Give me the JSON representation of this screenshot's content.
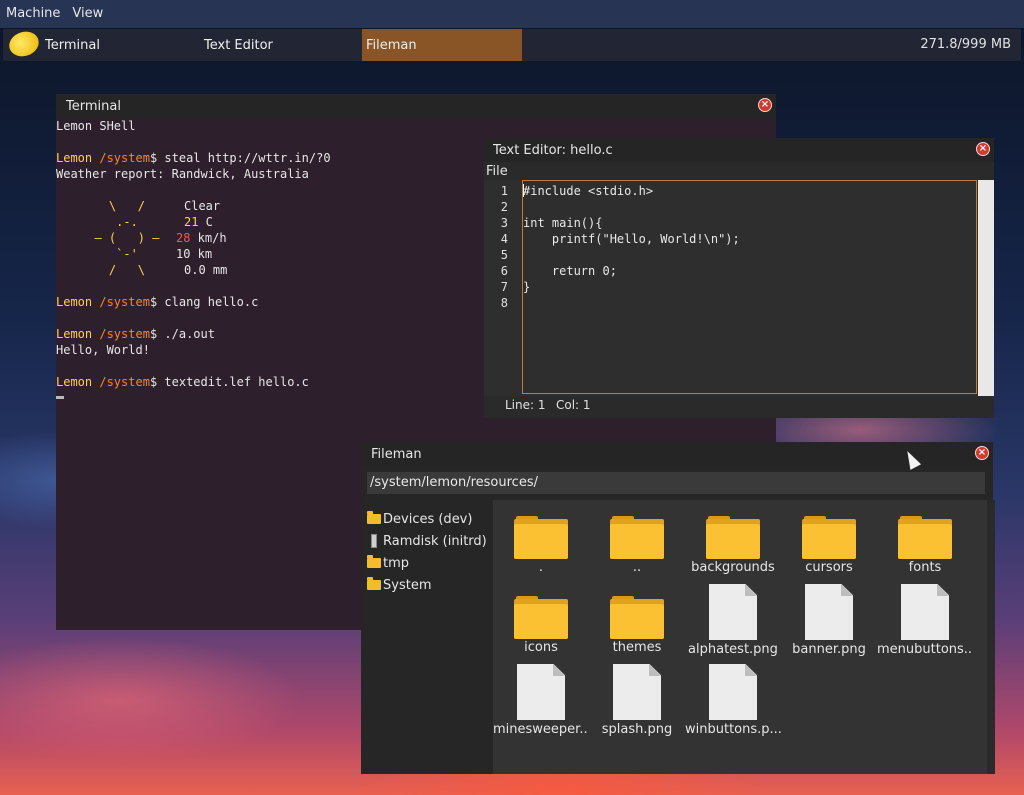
{
  "host_menu": [
    "Machine",
    "View"
  ],
  "taskbar": {
    "tasks": [
      "Terminal",
      "Text Editor",
      "Fileman"
    ],
    "active_task": "Fileman",
    "memory": "271.8/999 MB",
    "logo_icon": "lemon-icon"
  },
  "terminal": {
    "title": "Terminal",
    "shell_name": "Lemon SHell",
    "prompt_user": "Lemon",
    "prompt_path": "/system",
    "prompt_suffix": "$ ",
    "cmd1": "steal http://wttr.in/?0",
    "weather_header": "Weather report: Randwick, Australia",
    "art1": "    \\   /",
    "art2": "     .-.",
    "art3": "  ― (   ) ―",
    "art4": "     `-'",
    "art5": "    /   \\",
    "condition": "Clear",
    "temp_value": "21",
    "temp_unit": " C",
    "wind_value": "28",
    "wind_unit": " km/h",
    "visibility": "10 km",
    "precip": "0.0 mm",
    "cmd2": "clang hello.c",
    "cmd3": "./a.out",
    "output": "Hello, World!",
    "cmd4": "textedit.lef hello.c"
  },
  "text_editor": {
    "title": "Text Editor: hello.c",
    "menu_file": "File",
    "line_numbers": [
      "1",
      "2",
      "3",
      "4",
      "5",
      "6",
      "7",
      "8"
    ],
    "code_lines": [
      "#include <stdio.h>",
      "",
      "int main(){",
      "    printf(\"Hello, World!\\n\");",
      "",
      "    return 0;",
      "}",
      ""
    ],
    "status_line": "Line: 1",
    "status_col": "Col: 1"
  },
  "fileman": {
    "title": "Fileman",
    "path": "/system/lemon/resources/",
    "sidebar": [
      {
        "label": "Devices (dev)",
        "icon": "folder-icon"
      },
      {
        "label": "Ramdisk (initrd)",
        "icon": "drive-icon"
      },
      {
        "label": "tmp",
        "icon": "folder-icon"
      },
      {
        "label": "System",
        "icon": "folder-icon"
      }
    ],
    "items": [
      {
        "label": ".",
        "type": "folder"
      },
      {
        "label": "..",
        "type": "folder"
      },
      {
        "label": "backgrounds",
        "type": "folder"
      },
      {
        "label": "cursors",
        "type": "folder"
      },
      {
        "label": "fonts",
        "type": "folder"
      },
      {
        "label": "icons",
        "type": "folder"
      },
      {
        "label": "themes",
        "type": "folder"
      },
      {
        "label": "alphatest.png",
        "type": "file"
      },
      {
        "label": "banner.png",
        "type": "file"
      },
      {
        "label": "menubuttons....",
        "type": "file"
      },
      {
        "label": "minesweeper....",
        "type": "file"
      },
      {
        "label": "splash.png",
        "type": "file"
      },
      {
        "label": "winbuttons.p...",
        "type": "file"
      }
    ]
  }
}
